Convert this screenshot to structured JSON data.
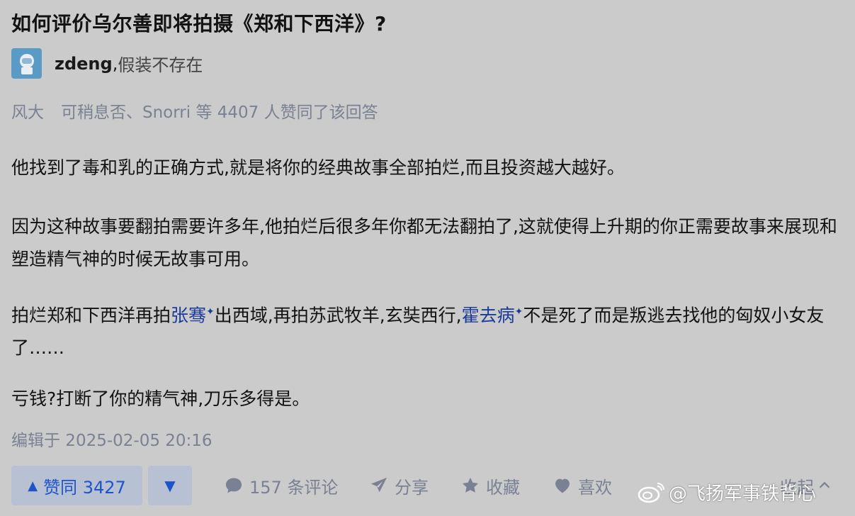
{
  "question": {
    "title": "如何评价乌尔善即将拍摄《郑和下西洋》?"
  },
  "author": {
    "name": "zdeng",
    "separator": ",",
    "bio": "假装不存在"
  },
  "voters": {
    "first": "风大",
    "rest": "可稍息否、Snorri 等 4407 人赞同了该回答"
  },
  "content": {
    "p1": "他找到了毒和乳的正确方式,就是将你的经典故事全部拍烂,而且投资越大越好。",
    "p2": "因为这种故事要翻拍需要许多年,他拍烂后很多年你都无法翻拍了,这就使得上升期的你正需要故事来展现和塑造精气神的时候无故事可用。",
    "p3_a": "拍烂郑和下西洋再拍",
    "p3_link1": "张骞",
    "p3_b": "出西域,再拍苏武牧羊,玄奘西行,",
    "p3_link2": "霍去病",
    "p3_c": "不是死了而是叛逃去找他的匈奴小女友了……",
    "p4": "亏钱?打断了你的精气神,刀乐多得是。",
    "spark": "✦"
  },
  "edited": "编辑于 2025-02-05 20:16",
  "actions": {
    "upvote_label": "赞同 3427",
    "upvote_icon": "▲",
    "downvote_icon": "▼",
    "comments": "157 条评论",
    "share": "分享",
    "favorite": "收藏",
    "like": "喜欢",
    "collapse": "收起"
  },
  "watermark": {
    "text": "@飞扬军事铁背心"
  },
  "colors": {
    "background": "#cbcbcb",
    "link": "#1a3a9a",
    "vote": "#1d55c8",
    "muted": "#7a8192"
  }
}
